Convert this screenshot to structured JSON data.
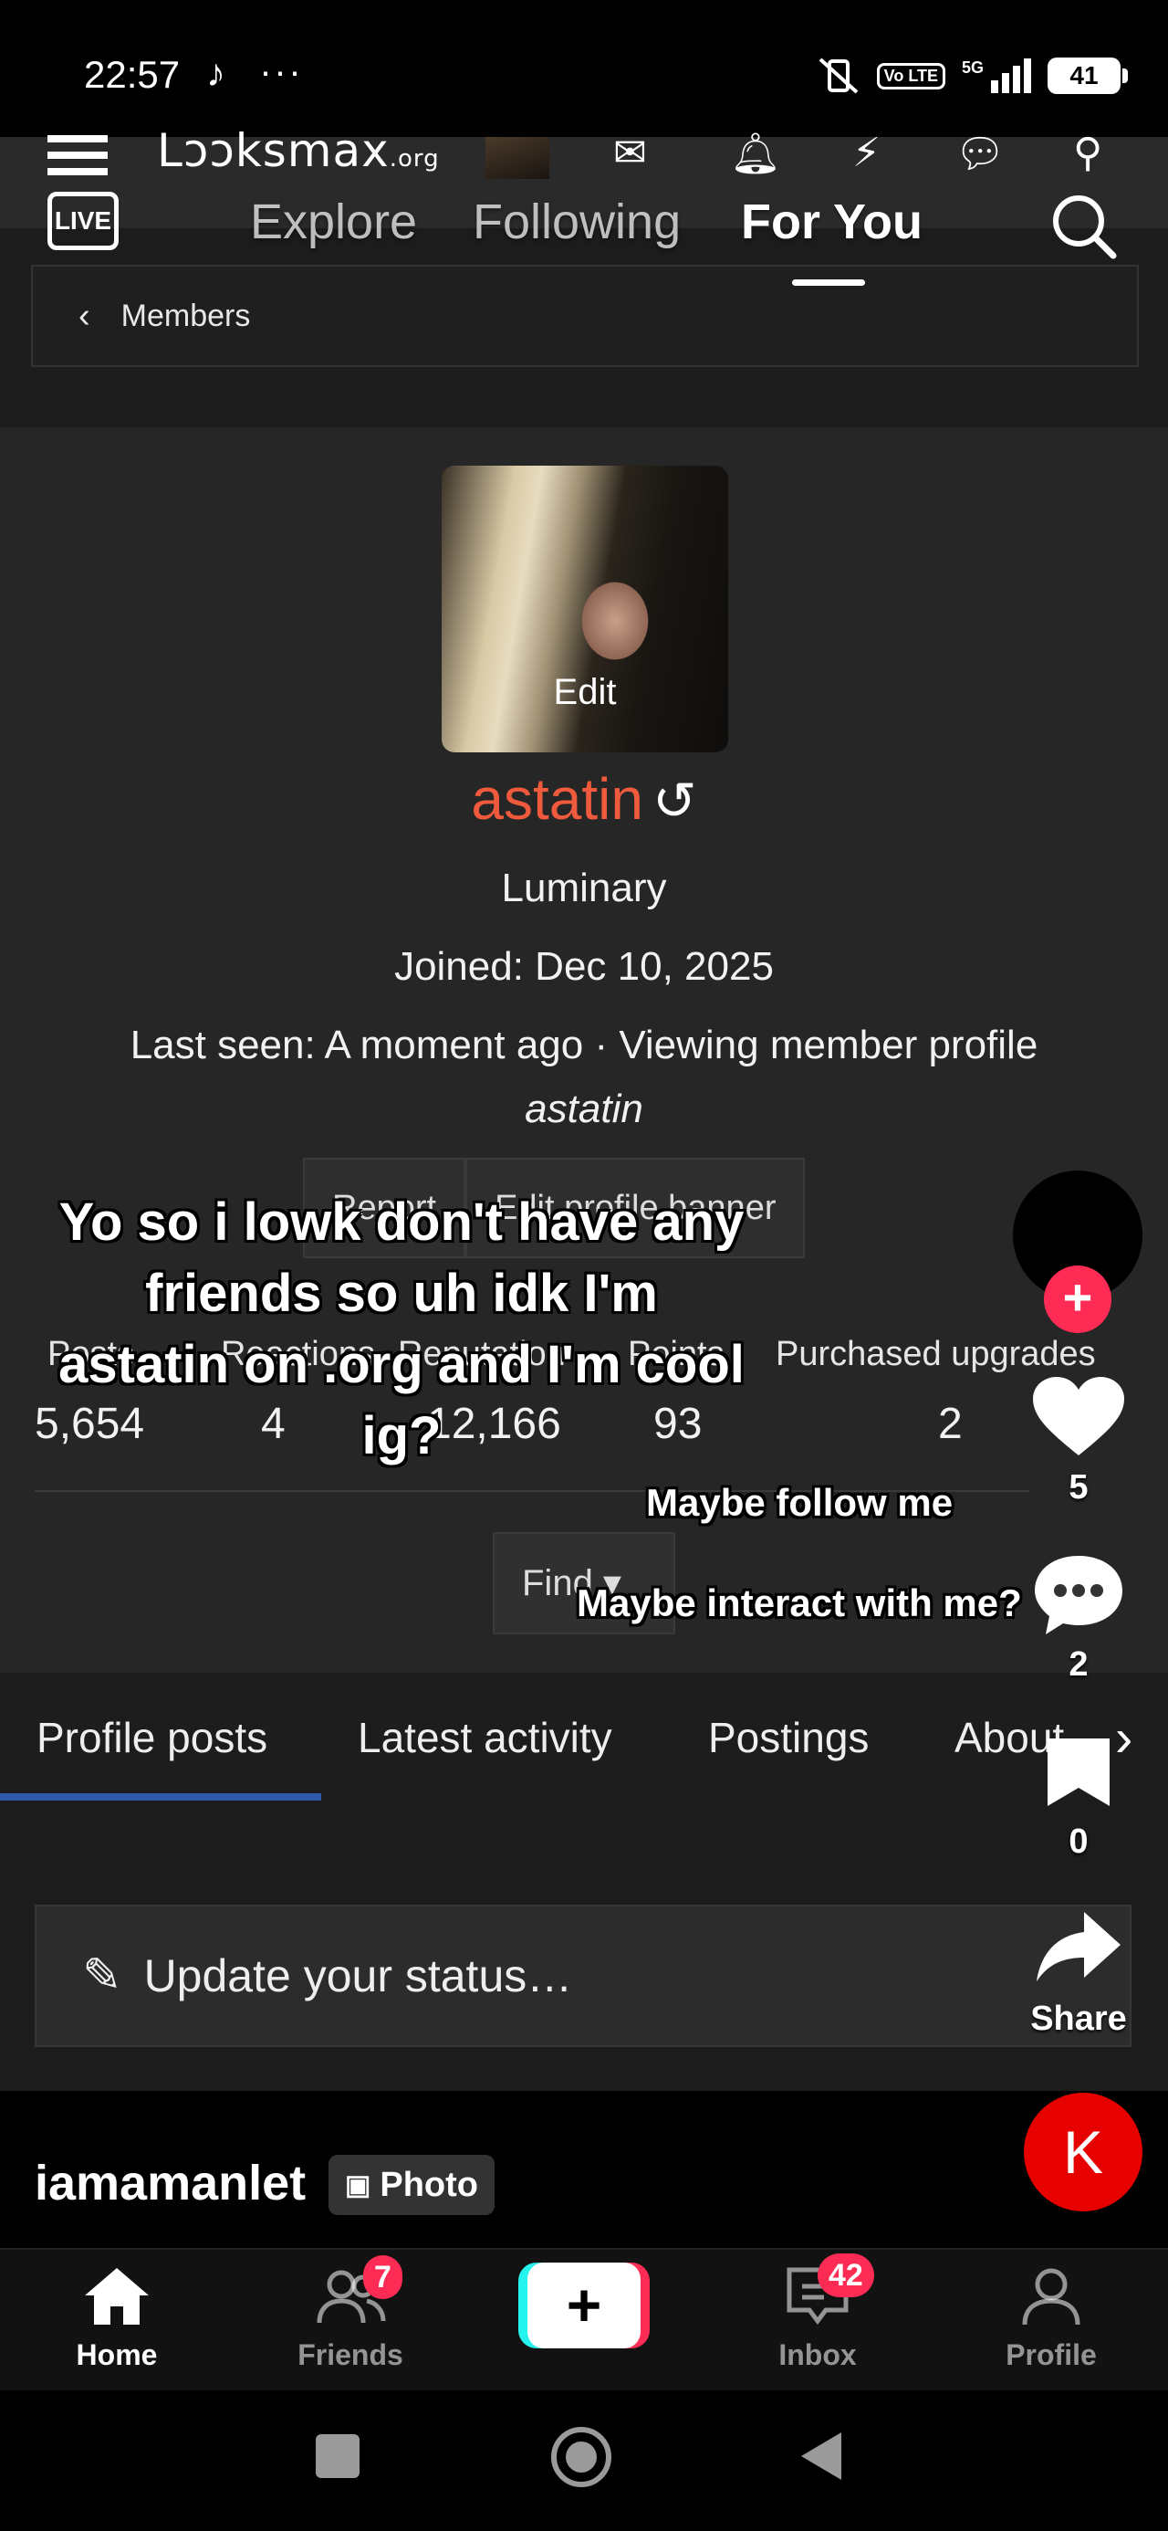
{
  "status_bar": {
    "time": "22:57",
    "dots": "···",
    "volte": "Vo LTE",
    "network": "5G",
    "battery": "41"
  },
  "website": {
    "logo": "Lɔɔksmax",
    "logo_suffix": ".org",
    "breadcrumb": "Members",
    "avatar_edit": "Edit",
    "username": "astatin",
    "title": "Luminary",
    "joined": "Joined: Dec 10, 2025",
    "last_seen": "Last seen: A moment ago · Viewing member profile",
    "last_seen_name": "astatin",
    "buttons": [
      "Report",
      "Edit profile banner"
    ],
    "stats": [
      {
        "label": "Posts",
        "value": "5,654"
      },
      {
        "label": "Reactions",
        "value": "4"
      },
      {
        "label": "Reputation",
        "value": "12,166"
      },
      {
        "label": "Points",
        "value": "93"
      },
      {
        "label": "Purchased upgrades",
        "value": "2"
      }
    ],
    "find_button": "Find ▾",
    "tabs": [
      "Profile posts",
      "Latest activity",
      "Postings",
      "About"
    ],
    "status_placeholder": "Update your status…"
  },
  "tiktok": {
    "nav": {
      "explore": "Explore",
      "following": "Following",
      "for_you": "For You"
    },
    "live_label": "LIVE",
    "caption_main": "Yo so i lowk don't have any friends so uh idk I'm astatin on .org and I'm cool ig?",
    "caption_follow": "Maybe follow me",
    "caption_interact": "Maybe interact with me?",
    "likes": "5",
    "comments": "2",
    "saves": "0",
    "share_label": "Share",
    "creator": "iamamanlet",
    "photo_badge": "Photo",
    "k_label": "K",
    "bottom_nav": {
      "home": "Home",
      "friends": "Friends",
      "friends_badge": "7",
      "inbox": "Inbox",
      "inbox_badge": "42",
      "profile": "Profile"
    }
  },
  "colors": {
    "username": "#f05a3c",
    "tiktok_red": "#fe2c55",
    "tiktok_cyan": "#25f4ee",
    "tab_underline": "#2f5aa8"
  }
}
